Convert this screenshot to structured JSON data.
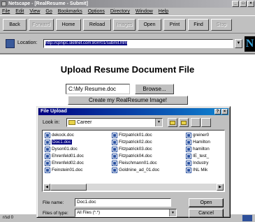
{
  "window": {
    "title": "Netscape - [RealResume - Submit]",
    "controls": [
      "_",
      "□",
      "×"
    ]
  },
  "menu": [
    "File",
    "Edit",
    "View",
    "Go",
    "Bookmarks",
    "Options",
    "Directory",
    "Window",
    "Help"
  ],
  "toolbar": {
    "back": "Back",
    "forward": "Forward",
    "home": "Home",
    "reload": "Reload",
    "images": "Images",
    "open": "Open",
    "print": "Print",
    "find": "Find",
    "stop": "Stop"
  },
  "location": {
    "label": "Location:",
    "url": "http://cpnipc.skillnet.com:80/rr01/submit.htm",
    "logo": "N"
  },
  "page": {
    "title": "Upload Resume Document File",
    "file_value": "C:\\My Resume.doc",
    "browse_label": "Browse...",
    "create_label": "Create my RealResume Image!"
  },
  "status": {
    "left_text": "r/sd 0"
  },
  "dialog": {
    "title": "File Upload",
    "title_buttons": [
      "?",
      "×"
    ],
    "look_in_label": "Look in:",
    "look_in_value": "Career",
    "columns": [
      [
        "dekock.doc",
        "Doc1.doc",
        "Dyson01.doc",
        "Ehrenfeld01.doc",
        "Ehrenfeld02.doc",
        "Feinstein01.doc"
      ],
      [
        "Fitzpatrick01.doc",
        "Fitzpatrick02.doc",
        "Fitzpatrick03.doc",
        "Fitzpatrick04.doc",
        "Fleischmann01.doc",
        "Goldnine_ad_01.doc"
      ],
      [
        "greiner0",
        "Hamilton",
        "hamilton",
        "IE_test_",
        "Industry",
        "INL Mik"
      ]
    ],
    "selected_file": "Doc1.doc",
    "file_name_label": "File name:",
    "file_name_value": "Doc1.doc",
    "file_type_label": "Files of type:",
    "file_type_value": "All Files (*.*)",
    "open_button": "Open",
    "cancel_button": "Cancel"
  }
}
